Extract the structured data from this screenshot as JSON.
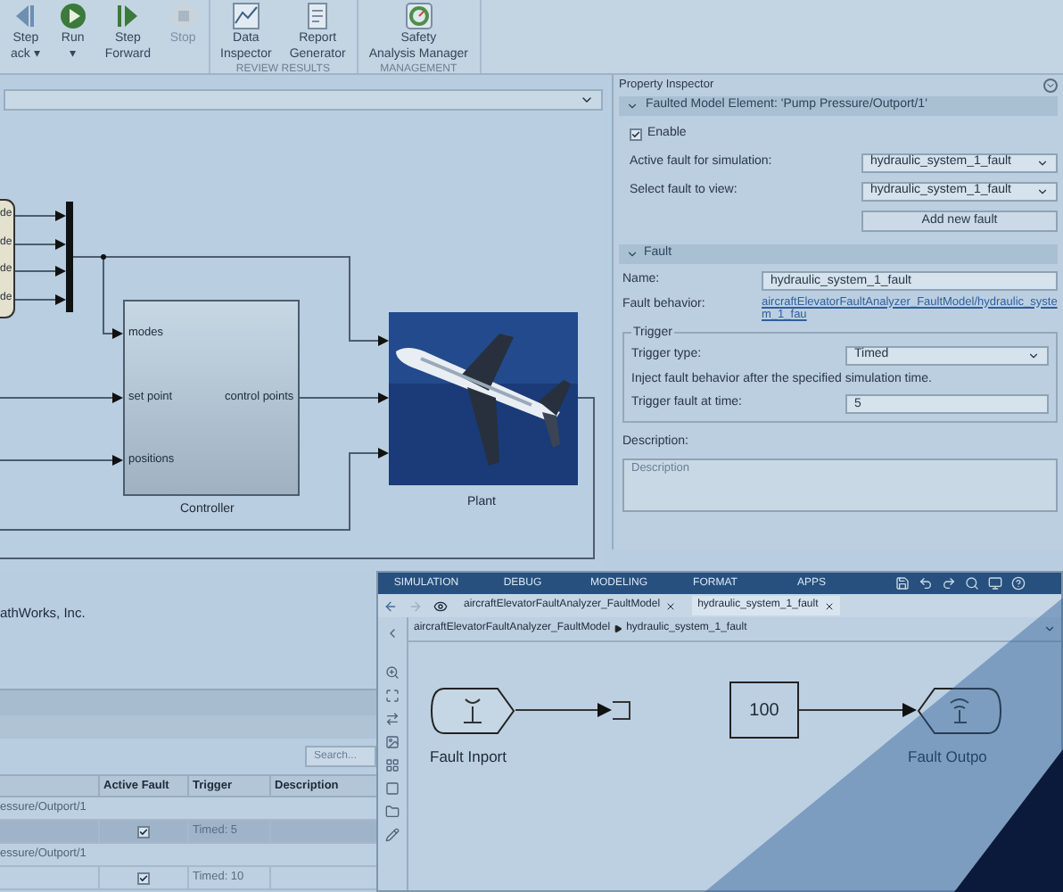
{
  "toolstrip": {
    "sections": [
      {
        "buttons": [
          {
            "kind": "back",
            "lines": [
              "Step",
              "ack ▾"
            ],
            "disabled": false
          },
          {
            "kind": "run",
            "lines": [
              "Run",
              "▾"
            ],
            "disabled": false
          },
          {
            "kind": "forward",
            "lines": [
              "Step",
              "Forward"
            ],
            "disabled": false
          },
          {
            "kind": "stop",
            "lines": [
              "Stop"
            ],
            "disabled": true
          }
        ]
      },
      {
        "label": "REVIEW RESULTS",
        "buttons": [
          {
            "kind": "inspector",
            "lines": [
              "Data",
              "Inspector"
            ],
            "disabled": false
          },
          {
            "kind": "report",
            "lines": [
              "Report",
              "Generator"
            ],
            "disabled": false
          }
        ]
      },
      {
        "label": "MANAGEMENT",
        "buttons": [
          {
            "kind": "safety",
            "lines": [
              "Safety",
              "Analysis Manager"
            ],
            "disabled": false
          }
        ]
      }
    ]
  },
  "diagram": {
    "bus_labels": [
      "de",
      "de",
      "de",
      "de"
    ],
    "controller": {
      "title": "Controller",
      "inputs": [
        "modes",
        "set point",
        "positions"
      ],
      "output": "control points"
    },
    "plant": {
      "title": "Plant",
      "kind": "picture"
    }
  },
  "property_inspector": {
    "title": "Property Inspector",
    "element_section": {
      "title": "Faulted Model Element: 'Pump Pressure/Outport/1'",
      "expanded": true,
      "enable": {
        "label": "Enable",
        "checked": true
      },
      "active_fault": {
        "label": "Active fault for simulation:",
        "value": "hydraulic_system_1_fault"
      },
      "fault_to_view": {
        "label": "Select fault to view:",
        "value": "hydraulic_system_1_fault"
      },
      "add_button": "Add new fault"
    },
    "fault_section": {
      "title": "Fault",
      "expanded": true,
      "name": {
        "label": "Name:",
        "value": "hydraulic_system_1_fault"
      },
      "behavior": {
        "label": "Fault behavior:",
        "link": "aircraftElevatorFaultAnalyzer_FaultModel/hydraulic_system_1_fau"
      },
      "trigger": {
        "title": "Trigger",
        "type_label": "Trigger type:",
        "type_value": "Timed",
        "note": "Inject fault behavior after the specified simulation time.",
        "time_label": "Trigger fault at time:",
        "time_value": "5"
      },
      "description": {
        "label": "Description:",
        "placeholder": "Description"
      }
    }
  },
  "copyright": "athWorks, Inc.",
  "fault_table": {
    "search": {
      "placeholder": "Search..."
    },
    "columns": [
      "Active Fault",
      "Trigger",
      "Description"
    ],
    "rows": [
      {
        "kind": "group",
        "label": "essure/Outport/1",
        "selected": false
      },
      {
        "kind": "fault",
        "active": true,
        "trigger": "Timed: 5",
        "selected": true
      },
      {
        "kind": "group",
        "label": "essure/Outport/1",
        "selected": false
      },
      {
        "kind": "fault",
        "active": true,
        "trigger": "Timed: 10",
        "selected": false
      }
    ]
  },
  "subsystem_window": {
    "ribbon_tabs": [
      "SIMULATION",
      "DEBUG",
      "MODELING",
      "FORMAT",
      "APPS"
    ],
    "doc_tabs": [
      {
        "label": "aircraftElevatorFaultAnalyzer_FaultModel",
        "selected": false
      },
      {
        "label": "hydraulic_system_1_fault",
        "selected": true
      }
    ],
    "breadcrumb": [
      "aircraftElevatorFaultAnalyzer_FaultModel",
      "hydraulic_system_1_fault"
    ],
    "inport": "Fault Inport",
    "constant": "100",
    "outport": "Fault Outpo"
  }
}
